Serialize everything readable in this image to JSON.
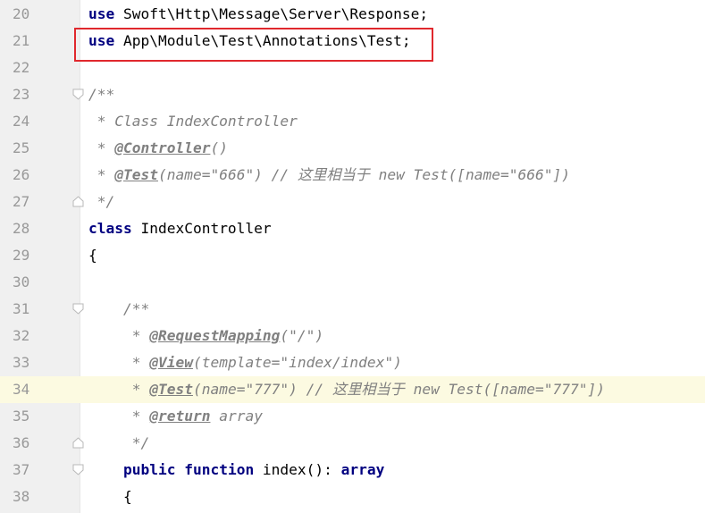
{
  "editor": {
    "lines": [
      {
        "num": "20",
        "segments": [
          {
            "t": "use",
            "c": "kw"
          },
          {
            "t": " Swoft\\Http\\Message\\Server\\Response;",
            "c": ""
          }
        ]
      },
      {
        "num": "21",
        "segments": [
          {
            "t": "use",
            "c": "kw"
          },
          {
            "t": " App\\Module\\Test\\Annotations\\Test;",
            "c": ""
          }
        ]
      },
      {
        "num": "22",
        "segments": []
      },
      {
        "num": "23",
        "fold": "open",
        "segments": [
          {
            "t": "/**",
            "c": "cm"
          }
        ]
      },
      {
        "num": "24",
        "segments": [
          {
            "t": " * Class IndexController",
            "c": "cm"
          }
        ]
      },
      {
        "num": "25",
        "segments": [
          {
            "t": " * ",
            "c": "cm"
          },
          {
            "t": "@Controller",
            "c": "tag"
          },
          {
            "t": "()",
            "c": "cm"
          }
        ]
      },
      {
        "num": "26",
        "segments": [
          {
            "t": " * ",
            "c": "cm"
          },
          {
            "t": "@Test",
            "c": "tag"
          },
          {
            "t": "(name=\"666\") // 这里相当于 new Test([name=\"666\"])",
            "c": "cm"
          }
        ]
      },
      {
        "num": "27",
        "fold": "close",
        "segments": [
          {
            "t": " */",
            "c": "cm"
          }
        ]
      },
      {
        "num": "28",
        "segments": [
          {
            "t": "class",
            "c": "kw"
          },
          {
            "t": " IndexController",
            "c": ""
          }
        ]
      },
      {
        "num": "29",
        "segments": [
          {
            "t": "{",
            "c": ""
          }
        ]
      },
      {
        "num": "30",
        "segments": []
      },
      {
        "num": "31",
        "fold": "open",
        "segments": [
          {
            "t": "    /**",
            "c": "cm"
          }
        ]
      },
      {
        "num": "32",
        "segments": [
          {
            "t": "     * ",
            "c": "cm"
          },
          {
            "t": "@RequestMapping",
            "c": "tag"
          },
          {
            "t": "(\"/\")",
            "c": "cm"
          }
        ]
      },
      {
        "num": "33",
        "segments": [
          {
            "t": "     * ",
            "c": "cm"
          },
          {
            "t": "@View",
            "c": "tag"
          },
          {
            "t": "(template=\"index/index\")",
            "c": "cm"
          }
        ]
      },
      {
        "num": "34",
        "current": true,
        "segments": [
          {
            "t": "     * ",
            "c": "cm"
          },
          {
            "t": "@Test",
            "c": "tag"
          },
          {
            "t": "(name=\"777\") // 这里相当于 new Test([name=\"777\"])",
            "c": "cm"
          }
        ]
      },
      {
        "num": "35",
        "segments": [
          {
            "t": "     * ",
            "c": "cm"
          },
          {
            "t": "@return",
            "c": "tag"
          },
          {
            "t": " array",
            "c": "cm"
          }
        ]
      },
      {
        "num": "36",
        "fold": "close",
        "segments": [
          {
            "t": "     */",
            "c": "cm"
          }
        ]
      },
      {
        "num": "37",
        "fold": "open",
        "segments": [
          {
            "t": "    ",
            "c": ""
          },
          {
            "t": "public",
            "c": "kw"
          },
          {
            "t": " ",
            "c": ""
          },
          {
            "t": "function",
            "c": "kw"
          },
          {
            "t": " index(): ",
            "c": ""
          },
          {
            "t": "array",
            "c": "kw"
          }
        ]
      },
      {
        "num": "38",
        "segments": [
          {
            "t": "    {",
            "c": ""
          }
        ]
      }
    ]
  },
  "highlight_color": "#e0282d",
  "colors": {
    "keyword": "#000080",
    "comment": "#808080",
    "current_line": "#fcfae1",
    "gutter": "#f0f0f0"
  }
}
